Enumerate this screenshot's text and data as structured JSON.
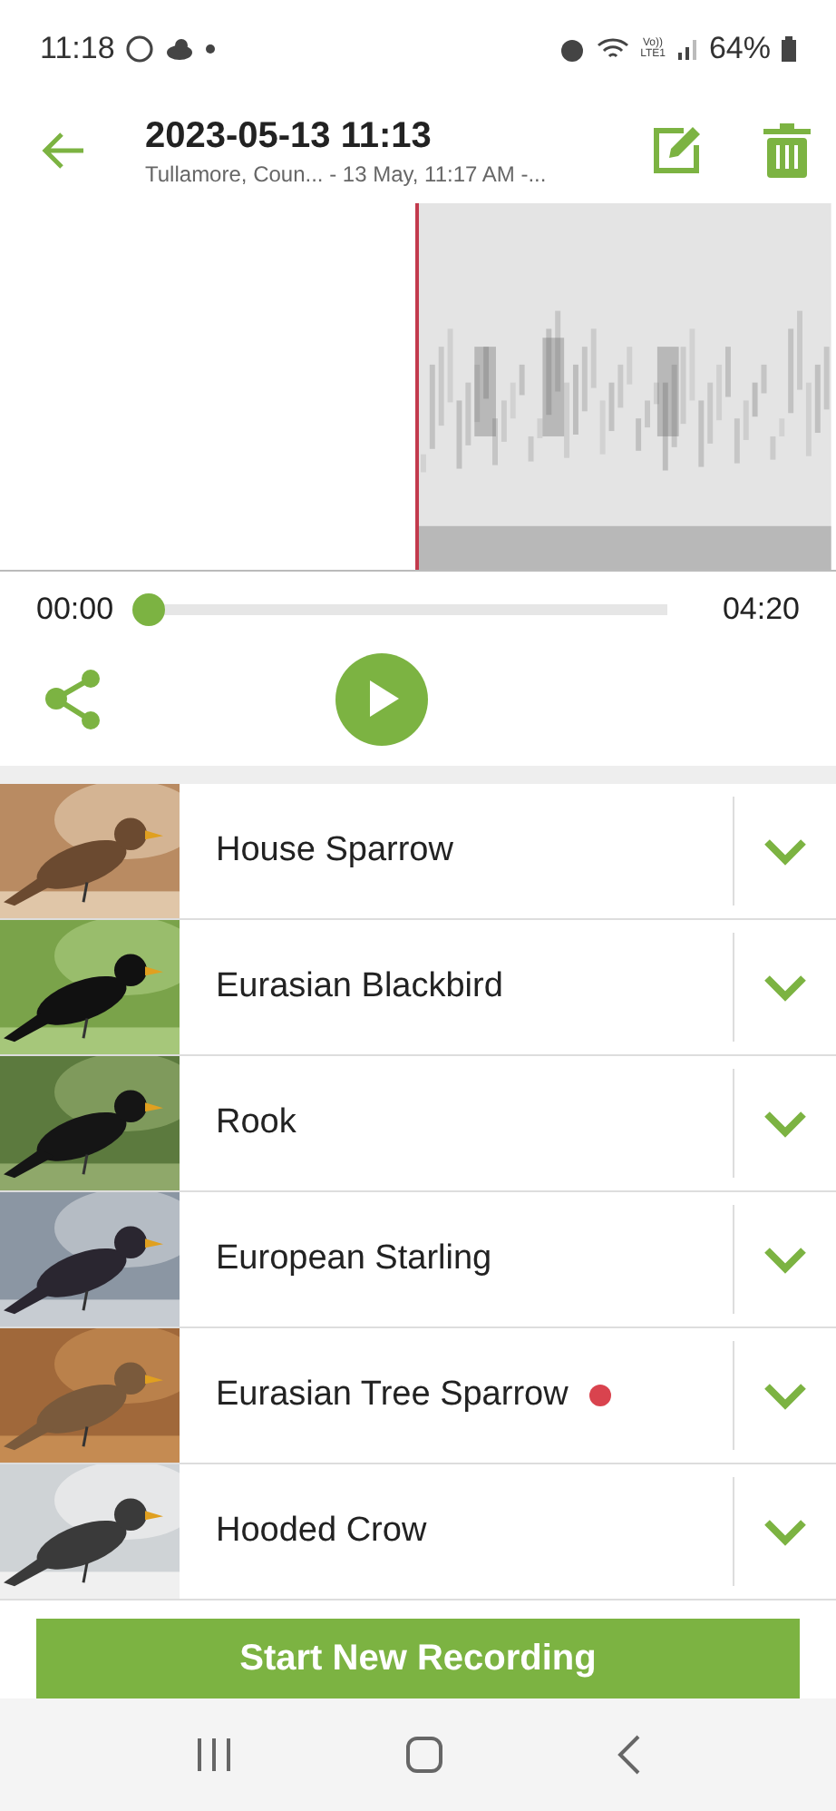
{
  "status_bar": {
    "time": "11:18",
    "battery": "64%",
    "network": "Vo))\nLTE1"
  },
  "header": {
    "title": "2023-05-13 11:13",
    "subtitle": "Tullamore, Coun... - 13 May, 11:17 AM -..."
  },
  "player": {
    "elapsed": "00:00",
    "duration": "04:20",
    "level": 0
  },
  "matches": [
    {
      "name": "House Sparrow",
      "marked": false
    },
    {
      "name": "Eurasian Blackbird",
      "marked": false
    },
    {
      "name": "Rook",
      "marked": false
    },
    {
      "name": "European Starling",
      "marked": false
    },
    {
      "name": "Eurasian Tree Sparrow",
      "marked": true
    },
    {
      "name": "Hooded Crow",
      "marked": false
    }
  ],
  "primary_button": "Start New Recording"
}
